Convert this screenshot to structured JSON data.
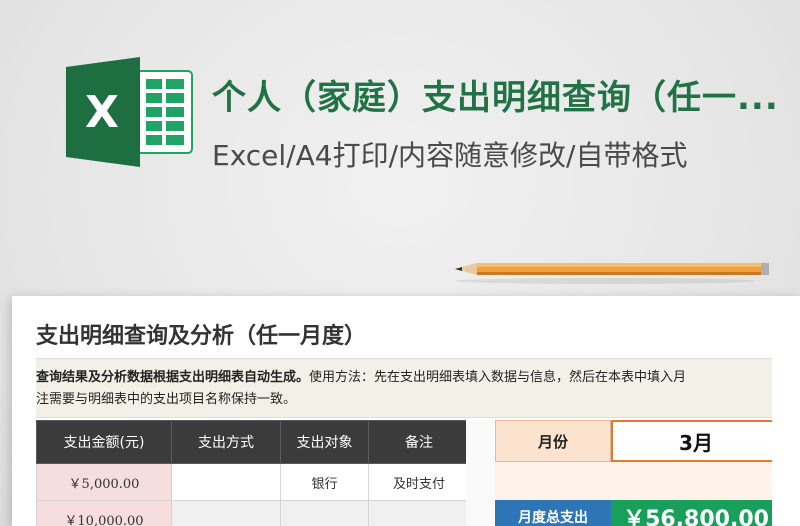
{
  "banner": {
    "title": "个人（家庭）支出明细查询（任一...",
    "subtitle": "Excel/A4打印/内容随意修改/自带格式",
    "logo_letter": "X"
  },
  "sheet": {
    "title": "支出明细查询及分析（任一月度）",
    "note_bold": "查询结果及分析数据根据支出明细表自动生成。",
    "note_rest": "使用方法：先在支出明细表填入数据与信息，然后在本表中填入月",
    "note_line2": "注需要与明细表中的支出项目名称保持一致。",
    "table": {
      "headers": [
        "支出金额(元)",
        "支出方式",
        "支出对象",
        "备注"
      ],
      "rows": [
        [
          "￥5,000.00",
          "",
          "银行",
          "及时支付"
        ],
        [
          "￥10,000.00",
          "",
          "",
          ""
        ]
      ]
    },
    "summary": {
      "month_label": "月份",
      "month_value": "3月",
      "total_label": "月度总支出",
      "total_value": "￥56,800.00"
    }
  },
  "colors": {
    "brand_green": "#217346",
    "header_dark": "#3b3b3b",
    "amount_pink": "#f6dede",
    "accent_orange": "#e07b2c",
    "total_blue": "#2e75b6",
    "total_green": "#18a05a"
  },
  "icons": [
    "excel-logo-icon",
    "pencil-icon"
  ]
}
